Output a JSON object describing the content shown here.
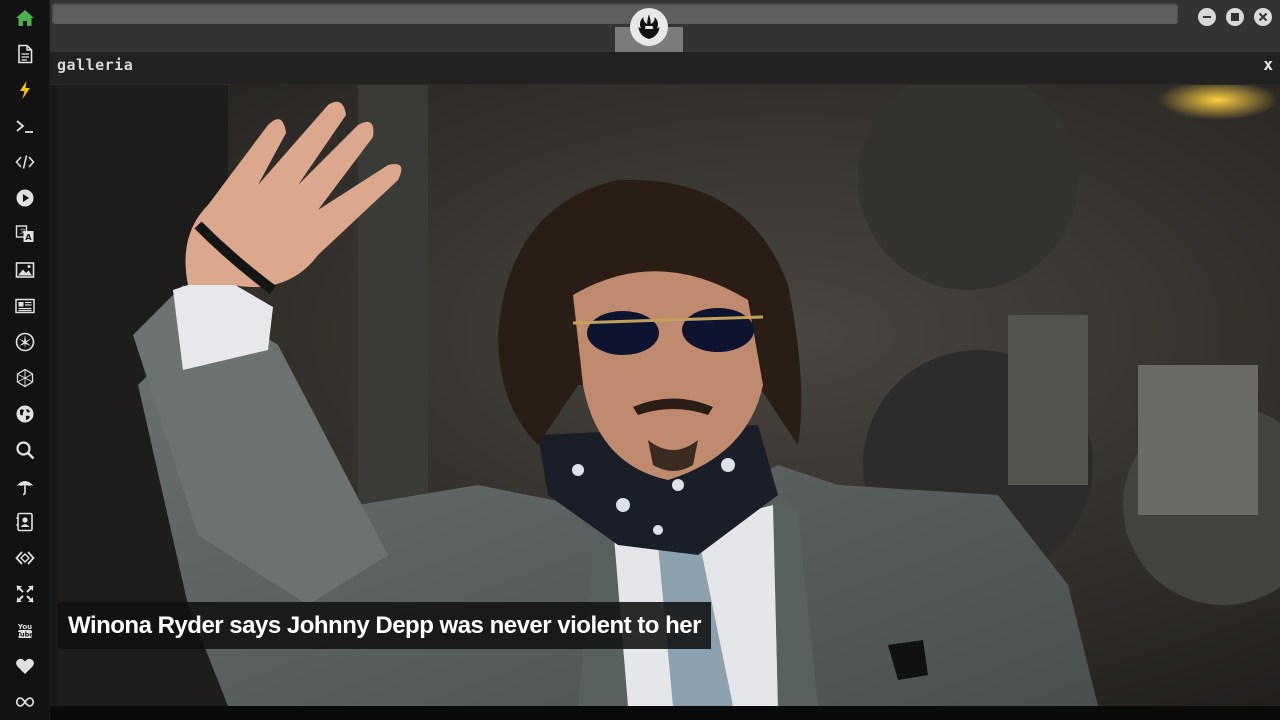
{
  "sidebar": {
    "items": [
      {
        "name": "home-icon",
        "color": "#4caf50"
      },
      {
        "name": "document-icon"
      },
      {
        "name": "lightning-icon"
      },
      {
        "name": "terminal-icon"
      },
      {
        "name": "code-icon"
      },
      {
        "name": "play-icon"
      },
      {
        "name": "translate-icon"
      },
      {
        "name": "image-icon"
      },
      {
        "name": "newspaper-icon"
      },
      {
        "name": "rebel-icon"
      },
      {
        "name": "hexagon-icon"
      },
      {
        "name": "globe-icon"
      },
      {
        "name": "search-icon"
      },
      {
        "name": "umbrella-icon"
      },
      {
        "name": "contact-icon"
      },
      {
        "name": "share-icon"
      },
      {
        "name": "expand-icon"
      },
      {
        "name": "youtube-icon"
      },
      {
        "name": "heart-icon"
      },
      {
        "name": "infinity-icon"
      }
    ]
  },
  "topbar": {
    "emblem": "rebel-alliance-icon",
    "window_buttons": [
      "minimize-icon",
      "maximize-icon",
      "close-icon"
    ]
  },
  "panel": {
    "title": "galleria",
    "close_label": "x"
  },
  "gallery": {
    "caption": "Winona Ryder says Johnny Depp was never violent to her"
  },
  "colors": {
    "accent": "#4caf50",
    "sidebar_bg": "#121212",
    "topbar_bg": "#333333",
    "panel_bg": "#222222"
  }
}
